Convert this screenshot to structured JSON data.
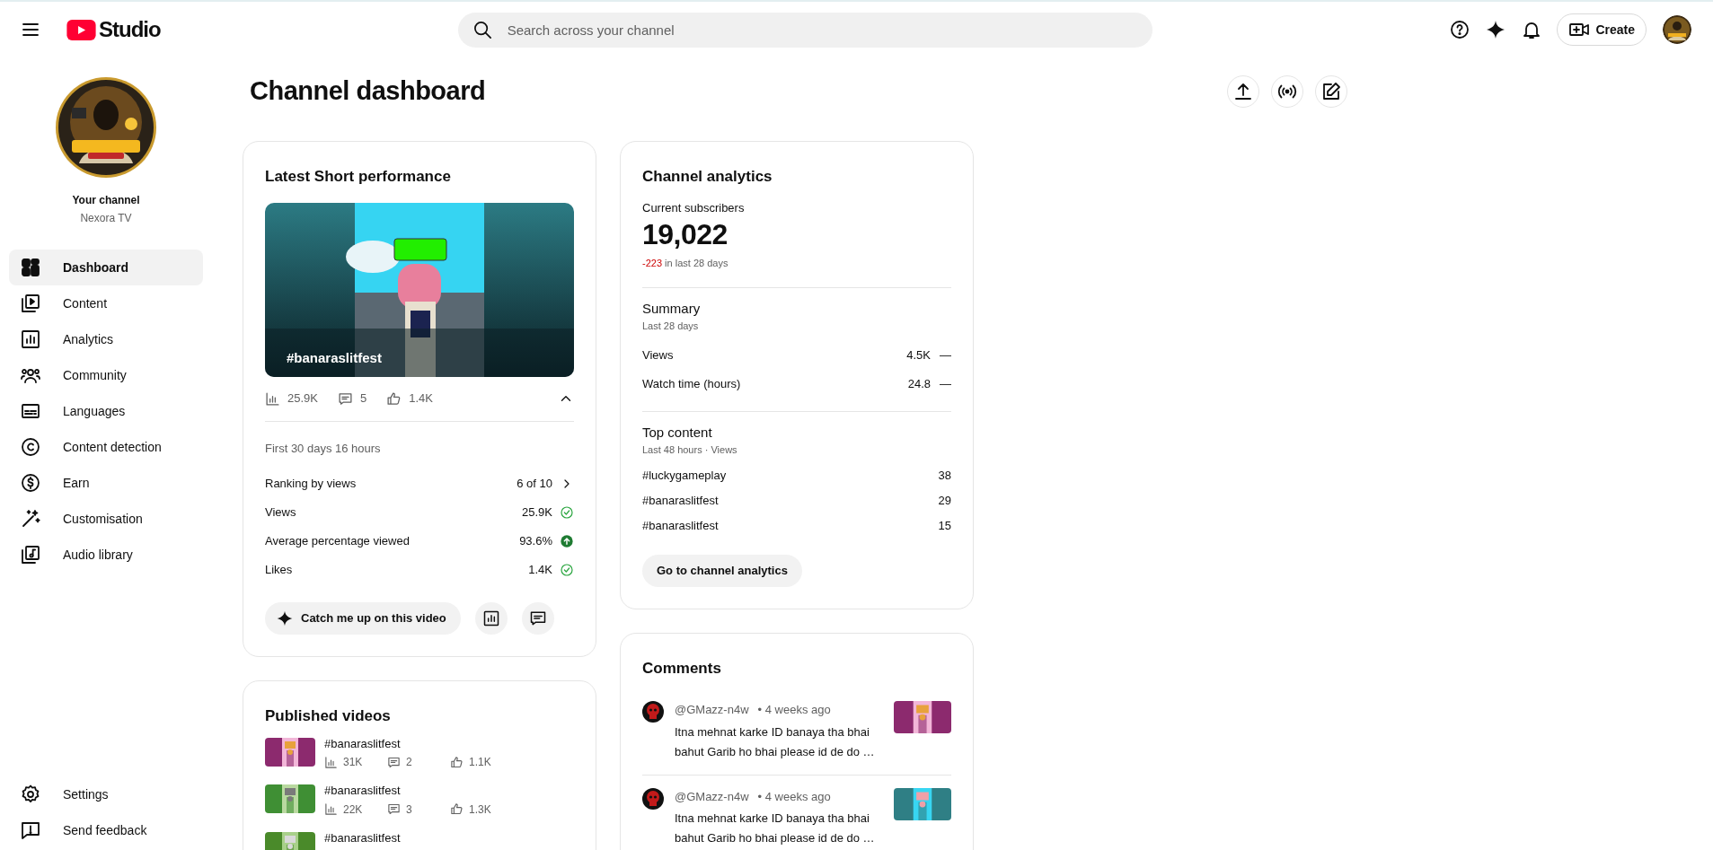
{
  "topbar": {
    "app_name": "Studio",
    "search": {
      "placeholder": "Search across your channel"
    },
    "create_label": "Create"
  },
  "sidebar": {
    "channel_label": "Your channel",
    "channel_name": "Nexora TV",
    "items": [
      {
        "label": "Dashboard",
        "selected": true
      },
      {
        "label": "Content",
        "selected": false
      },
      {
        "label": "Analytics",
        "selected": false
      },
      {
        "label": "Community",
        "selected": false
      },
      {
        "label": "Languages",
        "selected": false
      },
      {
        "label": "Content detection",
        "selected": false
      },
      {
        "label": "Earn",
        "selected": false
      },
      {
        "label": "Customisation",
        "selected": false
      },
      {
        "label": "Audio library",
        "selected": false
      }
    ],
    "footer_items": [
      {
        "label": "Settings"
      },
      {
        "label": "Send feedback"
      }
    ]
  },
  "page_title": "Channel dashboard",
  "latest_short": {
    "title": "Latest Short performance",
    "video_title": "#banaraslitfest",
    "stats": [
      {
        "kind": "views",
        "value": "25.9K"
      },
      {
        "kind": "comments",
        "value": "5"
      },
      {
        "kind": "likes",
        "value": "1.4K"
      }
    ],
    "expanded": true,
    "period": "First 30 days 16 hours",
    "metrics": [
      {
        "label": "Ranking by views",
        "value": "6 of 10",
        "kind": "link"
      },
      {
        "label": "Views",
        "value": "25.9K",
        "kind": "ok"
      },
      {
        "label": "Average percentage viewed",
        "value": "93.6%",
        "kind": "rising"
      },
      {
        "label": "Likes",
        "value": "1.4K",
        "kind": "ok"
      }
    ],
    "action_label": "Catch me up on this video"
  },
  "published_videos": {
    "title": "Published videos",
    "videos": [
      {
        "title": "#banaraslitfest",
        "views": "31K",
        "comments": "2",
        "likes": "1.1K"
      },
      {
        "title": "#banaraslitfest",
        "views": "22K",
        "comments": "3",
        "likes": "1.3K"
      },
      {
        "title": "#banaraslitfest"
      }
    ]
  },
  "channel_analytics": {
    "title": "Channel analytics",
    "subscribers_label": "Current subscribers",
    "subscribers": "19,022",
    "change": "-223",
    "change_suffix": "in last 28 days",
    "summary": {
      "title": "Summary",
      "period": "Last 28 days",
      "rows": [
        {
          "label": "Views",
          "value": "4.5K",
          "trend": "—"
        },
        {
          "label": "Watch time (hours)",
          "value": "24.8",
          "trend": "—"
        }
      ]
    },
    "top_content": {
      "title": "Top content",
      "period": "Last 48 hours · Views",
      "rows": [
        {
          "label": "#luckygameplay",
          "value": "38"
        },
        {
          "label": "#banaraslitfest",
          "value": "29"
        },
        {
          "label": "#banaraslitfest",
          "value": "15"
        }
      ]
    },
    "button_label": "Go to channel analytics"
  },
  "comments": {
    "title": "Comments",
    "items": [
      {
        "author": "@GMazz-n4w",
        "time": "• 4 weeks ago",
        "text": "Itna mehnat karke ID banaya tha bhai bahut Garib ho bhai please id de do …"
      },
      {
        "author": "@GMazz-n4w",
        "time": "• 4 weeks ago",
        "text": "Itna mehnat karke ID banaya tha bhai bahut Garib ho bhai please id de do …"
      }
    ]
  }
}
